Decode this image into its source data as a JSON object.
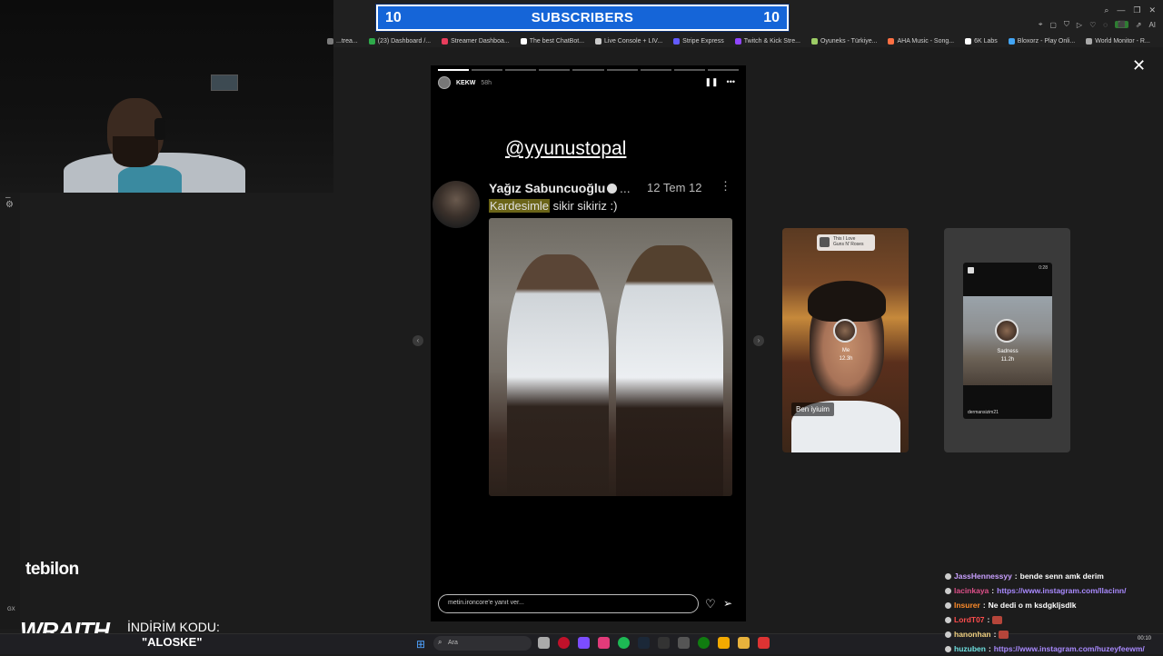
{
  "subscriber_banner": {
    "left_count": "10",
    "title": "SUBSCRIBERS",
    "right_count": "10"
  },
  "bookmarks": [
    {
      "label": "...trea...",
      "color": "#7b7b7b"
    },
    {
      "label": "(23) Dashboard /...",
      "color": "#2eaa4a"
    },
    {
      "label": "Streamer Dashboa...",
      "color": "#e83d5c"
    },
    {
      "label": "The best ChatBot...",
      "color": "#ffffff"
    },
    {
      "label": "Live Console + LIV...",
      "color": "#cccccc"
    },
    {
      "label": "Stripe Express",
      "color": "#635bff"
    },
    {
      "label": "Twitch & Kick Stre...",
      "color": "#9146ff"
    },
    {
      "label": "Oyuneks - Türkiye...",
      "color": "#9ccc65"
    },
    {
      "label": "AHA Music - Song...",
      "color": "#ff7043"
    },
    {
      "label": "6K Labs",
      "color": "#ffffff"
    },
    {
      "label": "Bloxorz - Play Onli...",
      "color": "#42a5f5"
    },
    {
      "label": "World Monitor - R...",
      "color": "#aaaaaa"
    }
  ],
  "chrome": {
    "ai_label": "AI"
  },
  "story": {
    "username": "KEKW",
    "time": "58h",
    "progress_segments": 9,
    "progress_done": 1,
    "mention": "@yyunustopal",
    "tweet": {
      "name": "Yağız Sabuncuoğlu",
      "ellipsis": "...",
      "date": "12 Tem 12",
      "text_highlight": "Kardesimle",
      "text_rest": " sikir sikiriz :)"
    },
    "reply_placeholder": "metin.ironcore'e yanıt ver..."
  },
  "preview1": {
    "music_title": "This I Love",
    "music_artist": "Guns N' Roses",
    "user": "Me",
    "time": "12.3h",
    "caption": "Ben iyiuim"
  },
  "preview2": {
    "time": "0:28",
    "title": "Sadness",
    "age": "11.2h",
    "user": "dermansizim21"
  },
  "overlays": {
    "tebilon": "tebilon",
    "wraith": "WRAITH.",
    "indirim": "İNDİRİM KODU:",
    "kod": "\"ALOSKE\"",
    "gx": "GX"
  },
  "taskbar": {
    "search": "Ara",
    "time": "00:10"
  },
  "chat": [
    {
      "user": "JassHennessyy",
      "user_color": "#c9a0ff",
      "msg": "bende senn amk derim",
      "type": "text"
    },
    {
      "user": "lacinkaya",
      "user_color": "#e0508a",
      "msg": "https://www.instagram.com/llacinn/",
      "type": "link"
    },
    {
      "user": "Insurer",
      "user_color": "#ff8c2a",
      "msg": "Ne dedi o m ksdgkljsdlk",
      "type": "text"
    },
    {
      "user": "LordT07",
      "user_color": "#ff4d4d",
      "msg": "",
      "type": "emote"
    },
    {
      "user": "hanonhan",
      "user_color": "#f0d080",
      "msg": "",
      "type": "emote"
    },
    {
      "user": "huzuben",
      "user_color": "#6ee0e0",
      "msg": "https://www.instagram.com/huzeyfeewm/",
      "type": "link"
    }
  ]
}
